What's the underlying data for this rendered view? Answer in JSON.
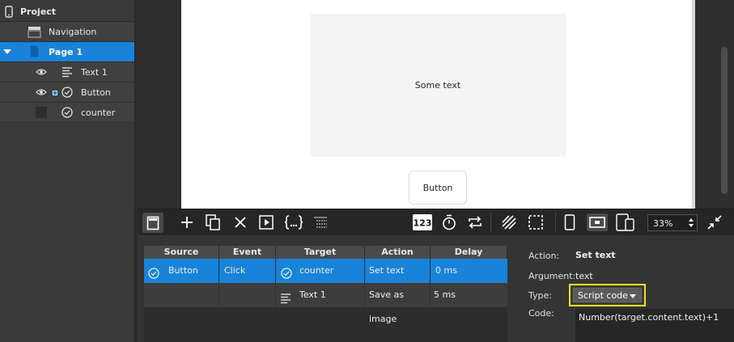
{
  "tree": {
    "project_label": "Project",
    "items": [
      {
        "label": "Navigation"
      },
      {
        "label": "Page 1"
      },
      {
        "label": "Text 1"
      },
      {
        "label": "Button"
      },
      {
        "label": "counter"
      }
    ]
  },
  "canvas": {
    "text_element": "Some text",
    "button_element": "Button"
  },
  "toolbar": {
    "zoom": "33%"
  },
  "interactions": {
    "columns": [
      "Source",
      "Event",
      "Target",
      "Action",
      "Delay"
    ],
    "rows": [
      {
        "source": "Button",
        "event": "Click",
        "target": "counter",
        "action": "Set text",
        "delay": "0 ms"
      },
      {
        "source": "",
        "event": "",
        "target": "Text 1",
        "action": "Save as image",
        "delay": "5 ms"
      }
    ]
  },
  "properties": {
    "action_label": "Action:",
    "action_value": "Set text",
    "argument_label": "Argument:",
    "argument_value": "text",
    "type_label": "Type:",
    "type_value": "Script code",
    "code_label": "Code:",
    "code_value": "Number(target.content.text)+1"
  },
  "colors": {
    "selection": "#1883d8",
    "highlight": "#f2e51d"
  }
}
